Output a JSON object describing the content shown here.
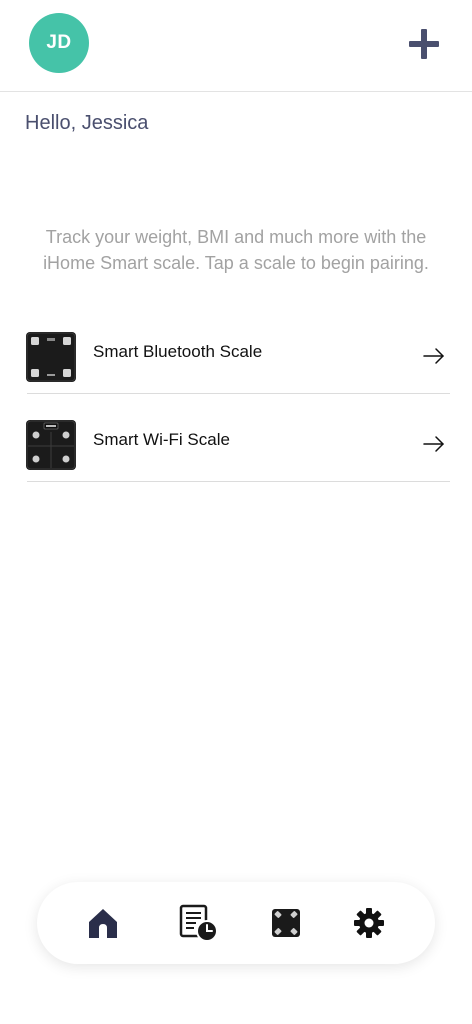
{
  "header": {
    "avatar_initials": "JD",
    "avatar_color": "#45c3a8",
    "add_icon": "plus-icon"
  },
  "greeting": "Hello, Jessica",
  "description": "Track your weight, BMI and much more with the iHome Smart scale. Tap a scale to begin pairing.",
  "scales": [
    {
      "label": "Smart Bluetooth Scale",
      "icon": "bluetooth-scale-thumbnail"
    },
    {
      "label": "Smart Wi-Fi Scale",
      "icon": "wifi-scale-thumbnail"
    }
  ],
  "bottom_nav": {
    "items": [
      {
        "icon": "home-icon",
        "active": true
      },
      {
        "icon": "history-icon",
        "active": false
      },
      {
        "icon": "scale-icon",
        "active": false
      },
      {
        "icon": "gear-icon",
        "active": false
      }
    ]
  },
  "colors": {
    "accent": "#45c3a8",
    "nav_active": "#2a2e4a",
    "text_primary": "#111111",
    "text_muted": "#a2a2a2"
  }
}
